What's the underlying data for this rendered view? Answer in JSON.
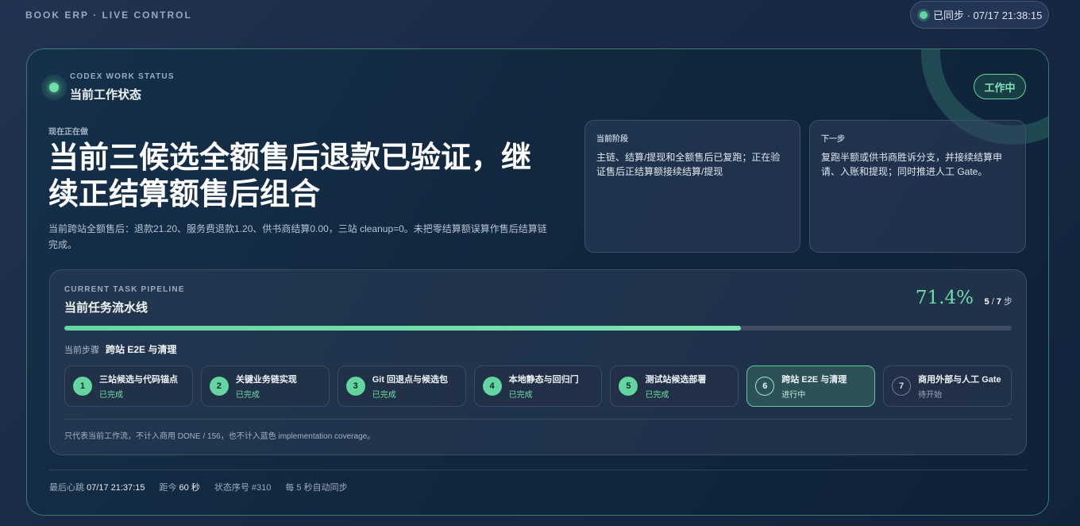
{
  "brand": "BOOK ERP · LIVE CONTROL",
  "sync": {
    "text": "已同步 · 07/17 21:38:15"
  },
  "header": {
    "eyebrow": "CODEX WORK STATUS",
    "title": "当前工作状态",
    "badge": "工作中"
  },
  "now": {
    "label": "现在正在做",
    "title": "当前三候选全额售后退款已验证，继续正结算额售后组合",
    "desc": "当前跨站全额售后：退款21.20、服务费退款1.20、供书商结算0.00，三站 cleanup=0。未把零结算额误算作售后结算链完成。"
  },
  "stage": {
    "label": "当前阶段",
    "text": "主链、结算/提现和全额售后已复跑；正在验证售后正结算额接续结算/提现"
  },
  "next": {
    "label": "下一步",
    "text": "复跑半额或供书商胜诉分支，并接续结算申请、入账和提现；同时推进人工 Gate。"
  },
  "pipeline": {
    "eyebrow": "CURRENT TASK PIPELINE",
    "title": "当前任务流水线",
    "percent_text": "71.4%",
    "progress": 0.714,
    "done": "5",
    "total": "7",
    "unit": "步",
    "current_label": "当前步骤",
    "current_value": "跨站 E2E 与清理",
    "steps": [
      {
        "num": "1",
        "name": "三站候选与代码锚点",
        "state": "已完成"
      },
      {
        "num": "2",
        "name": "关键业务链实现",
        "state": "已完成"
      },
      {
        "num": "3",
        "name": "Git 回退点与候选包",
        "state": "已完成"
      },
      {
        "num": "4",
        "name": "本地静态与回归门",
        "state": "已完成"
      },
      {
        "num": "5",
        "name": "测试站候选部署",
        "state": "已完成"
      },
      {
        "num": "6",
        "name": "跨站 E2E 与清理",
        "state": "进行中"
      },
      {
        "num": "7",
        "name": "商用外部与人工 Gate",
        "state": "待开始"
      }
    ],
    "note": "只代表当前工作流，不计入商用 DONE / 156，也不计入蓝色 implementation coverage。"
  },
  "footer": {
    "heartbeat_label": "最后心跳",
    "heartbeat_value": "07/17 21:37:15",
    "ago_label": "距今",
    "ago_value": "60 秒",
    "seq_label": "状态序号",
    "seq_value": "#310",
    "interval": "每 5 秒自动同步"
  },
  "colors": {
    "accent": "#6fdcaa",
    "background": "#1a2a45",
    "card_border": "#3d7a72"
  }
}
